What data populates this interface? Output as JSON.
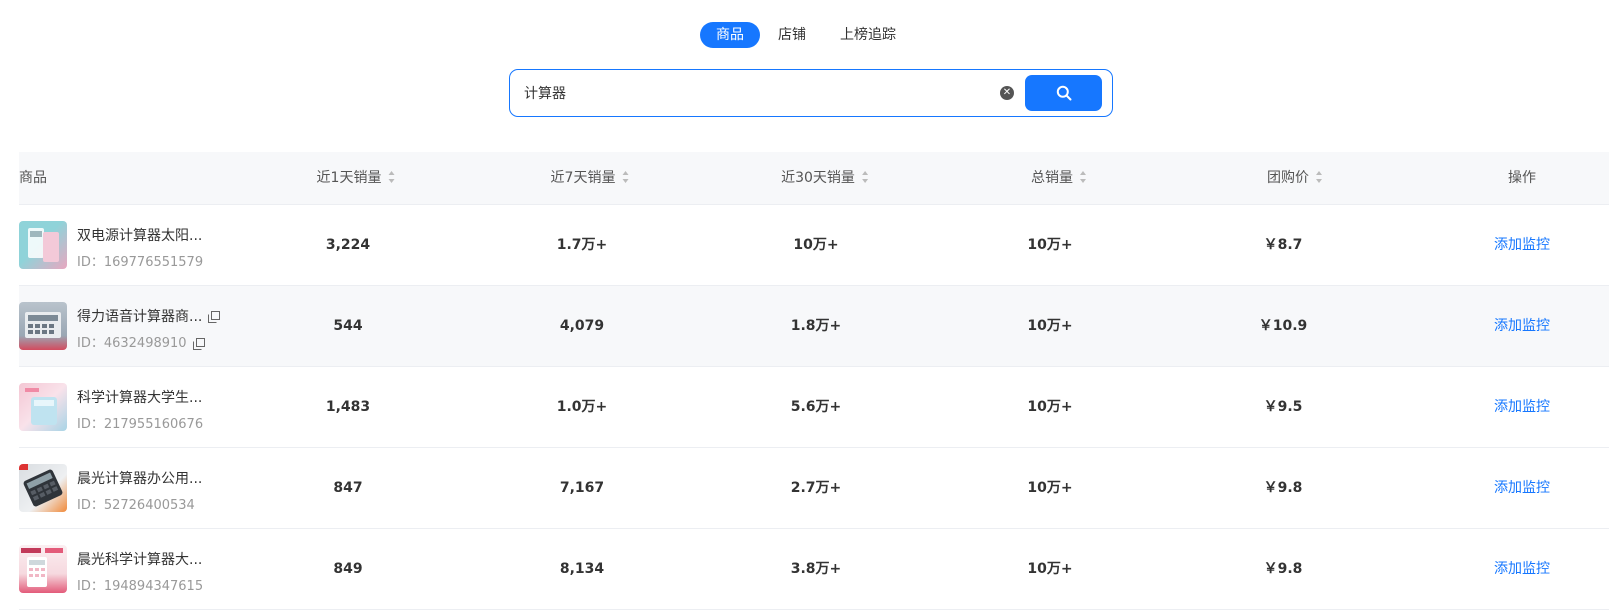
{
  "tabs": [
    {
      "label": "商品",
      "active": true
    },
    {
      "label": "店铺",
      "active": false
    },
    {
      "label": "上榜追踪",
      "active": false
    }
  ],
  "search": {
    "value": "计算器"
  },
  "colors": {
    "accent": "#1677ff",
    "header_bg": "#f7f8fa"
  },
  "table": {
    "headers": {
      "product": "商品",
      "sales_1d": "近1天销量",
      "sales_7d": "近7天销量",
      "sales_30d": "近30天销量",
      "sales_total": "总销量",
      "group_price": "团购价",
      "action": "操作"
    },
    "rows": [
      {
        "name": "双电源计算器太阳...",
        "id": "ID：169776551579",
        "sales_1d": "3,224",
        "sales_7d": "1.7万+",
        "sales_30d": "10万+",
        "sales_total": "10万+",
        "price": "￥8.7",
        "action": "添加监控",
        "thumb": [
          "#8fd3d9",
          "#e9a7c0"
        ]
      },
      {
        "name": "得力语音计算器商...",
        "id": "ID：4632498910",
        "sales_1d": "544",
        "sales_7d": "4,079",
        "sales_30d": "1.8万+",
        "sales_total": "10万+",
        "price": "￥10.9",
        "action": "添加监控",
        "thumb": [
          "#9aa7b4",
          "#d34b5e"
        ]
      },
      {
        "name": "科学计算器大学生...",
        "id": "ID：217955160676",
        "sales_1d": "1,483",
        "sales_7d": "1.0万+",
        "sales_30d": "5.6万+",
        "sales_total": "10万+",
        "price": "￥9.5",
        "action": "添加监控",
        "thumb": [
          "#f4c7d4",
          "#a8d4e6"
        ]
      },
      {
        "name": "晨光计算器办公用...",
        "id": "ID：52726400534",
        "sales_1d": "847",
        "sales_7d": "7,167",
        "sales_30d": "2.7万+",
        "sales_total": "10万+",
        "price": "￥9.8",
        "action": "添加监控",
        "thumb": [
          "#3b3f46",
          "#f08a3a"
        ]
      },
      {
        "name": "晨光科学计算器大...",
        "id": "ID：194894347615",
        "sales_1d": "849",
        "sales_7d": "8,134",
        "sales_30d": "3.8万+",
        "sales_total": "10万+",
        "price": "￥9.8",
        "action": "添加监控",
        "thumb": [
          "#f6d9df",
          "#e35b7a"
        ]
      }
    ]
  }
}
